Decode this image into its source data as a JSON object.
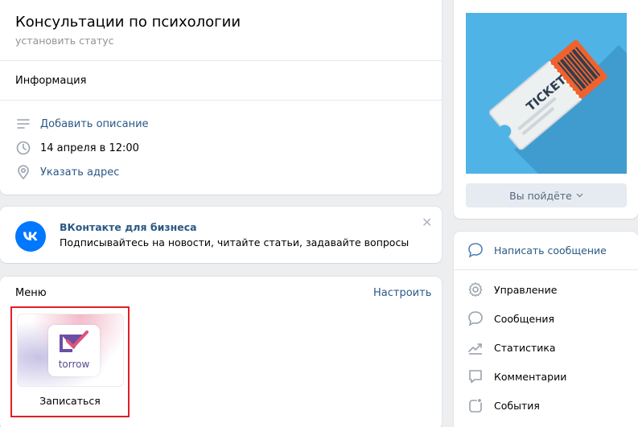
{
  "header": {
    "title": "Консультации по психологии",
    "status_link": "установить статус"
  },
  "info": {
    "section_title": "Информация",
    "rows": [
      {
        "icon": "description-lines-icon",
        "text": "Добавить описание"
      },
      {
        "icon": "clock-icon",
        "text": "14 апреля в 12:00"
      },
      {
        "icon": "location-pin-icon",
        "text": "Указать адрес"
      }
    ]
  },
  "business_promo": {
    "title": "ВКонтакте для бизнеса",
    "subtitle": "Подписывайтесь на новости, читайте статьи, задавайте вопросы",
    "logo_text": "VK",
    "close": "✕"
  },
  "menu": {
    "title": "Меню",
    "configure_label": "Настроить",
    "items": [
      {
        "app_name": "torrow",
        "label": "Записаться"
      }
    ]
  },
  "event_card": {
    "ticket_text": "TICKET",
    "going_button": "Вы пойдёте"
  },
  "actions": {
    "primary": "Написать сообщение",
    "items": [
      {
        "icon": "gear-icon",
        "label": "Управление"
      },
      {
        "icon": "chat-bubble-icon",
        "label": "Сообщения"
      },
      {
        "icon": "stats-chart-icon",
        "label": "Статистика"
      },
      {
        "icon": "comment-icon",
        "label": "Комментарии"
      },
      {
        "icon": "event-icon",
        "label": "События"
      }
    ]
  },
  "colors": {
    "link": "#2a5885",
    "highlight_border": "#e31e24",
    "photo_bg": "#4fb3e6",
    "ticket_orange": "#f0622d"
  }
}
